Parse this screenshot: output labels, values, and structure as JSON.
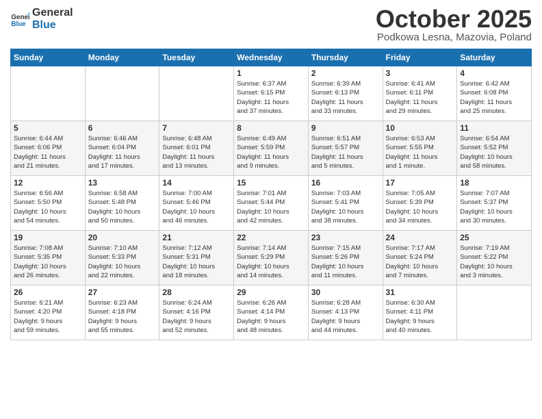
{
  "header": {
    "logo_general": "General",
    "logo_blue": "Blue",
    "month": "October 2025",
    "location": "Podkowa Lesna, Mazovia, Poland"
  },
  "days_of_week": [
    "Sunday",
    "Monday",
    "Tuesday",
    "Wednesday",
    "Thursday",
    "Friday",
    "Saturday"
  ],
  "weeks": [
    [
      {
        "day": "",
        "info": ""
      },
      {
        "day": "",
        "info": ""
      },
      {
        "day": "",
        "info": ""
      },
      {
        "day": "1",
        "info": "Sunrise: 6:37 AM\nSunset: 6:15 PM\nDaylight: 11 hours\nand 37 minutes."
      },
      {
        "day": "2",
        "info": "Sunrise: 6:39 AM\nSunset: 6:13 PM\nDaylight: 11 hours\nand 33 minutes."
      },
      {
        "day": "3",
        "info": "Sunrise: 6:41 AM\nSunset: 6:11 PM\nDaylight: 11 hours\nand 29 minutes."
      },
      {
        "day": "4",
        "info": "Sunrise: 6:42 AM\nSunset: 6:08 PM\nDaylight: 11 hours\nand 25 minutes."
      }
    ],
    [
      {
        "day": "5",
        "info": "Sunrise: 6:44 AM\nSunset: 6:06 PM\nDaylight: 11 hours\nand 21 minutes."
      },
      {
        "day": "6",
        "info": "Sunrise: 6:46 AM\nSunset: 6:04 PM\nDaylight: 11 hours\nand 17 minutes."
      },
      {
        "day": "7",
        "info": "Sunrise: 6:48 AM\nSunset: 6:01 PM\nDaylight: 11 hours\nand 13 minutes."
      },
      {
        "day": "8",
        "info": "Sunrise: 6:49 AM\nSunset: 5:59 PM\nDaylight: 11 hours\nand 9 minutes."
      },
      {
        "day": "9",
        "info": "Sunrise: 6:51 AM\nSunset: 5:57 PM\nDaylight: 11 hours\nand 5 minutes."
      },
      {
        "day": "10",
        "info": "Sunrise: 6:53 AM\nSunset: 5:55 PM\nDaylight: 11 hours\nand 1 minute."
      },
      {
        "day": "11",
        "info": "Sunrise: 6:54 AM\nSunset: 5:52 PM\nDaylight: 10 hours\nand 58 minutes."
      }
    ],
    [
      {
        "day": "12",
        "info": "Sunrise: 6:56 AM\nSunset: 5:50 PM\nDaylight: 10 hours\nand 54 minutes."
      },
      {
        "day": "13",
        "info": "Sunrise: 6:58 AM\nSunset: 5:48 PM\nDaylight: 10 hours\nand 50 minutes."
      },
      {
        "day": "14",
        "info": "Sunrise: 7:00 AM\nSunset: 5:46 PM\nDaylight: 10 hours\nand 46 minutes."
      },
      {
        "day": "15",
        "info": "Sunrise: 7:01 AM\nSunset: 5:44 PM\nDaylight: 10 hours\nand 42 minutes."
      },
      {
        "day": "16",
        "info": "Sunrise: 7:03 AM\nSunset: 5:41 PM\nDaylight: 10 hours\nand 38 minutes."
      },
      {
        "day": "17",
        "info": "Sunrise: 7:05 AM\nSunset: 5:39 PM\nDaylight: 10 hours\nand 34 minutes."
      },
      {
        "day": "18",
        "info": "Sunrise: 7:07 AM\nSunset: 5:37 PM\nDaylight: 10 hours\nand 30 minutes."
      }
    ],
    [
      {
        "day": "19",
        "info": "Sunrise: 7:08 AM\nSunset: 5:35 PM\nDaylight: 10 hours\nand 26 minutes."
      },
      {
        "day": "20",
        "info": "Sunrise: 7:10 AM\nSunset: 5:33 PM\nDaylight: 10 hours\nand 22 minutes."
      },
      {
        "day": "21",
        "info": "Sunrise: 7:12 AM\nSunset: 5:31 PM\nDaylight: 10 hours\nand 18 minutes."
      },
      {
        "day": "22",
        "info": "Sunrise: 7:14 AM\nSunset: 5:29 PM\nDaylight: 10 hours\nand 14 minutes."
      },
      {
        "day": "23",
        "info": "Sunrise: 7:15 AM\nSunset: 5:26 PM\nDaylight: 10 hours\nand 11 minutes."
      },
      {
        "day": "24",
        "info": "Sunrise: 7:17 AM\nSunset: 5:24 PM\nDaylight: 10 hours\nand 7 minutes."
      },
      {
        "day": "25",
        "info": "Sunrise: 7:19 AM\nSunset: 5:22 PM\nDaylight: 10 hours\nand 3 minutes."
      }
    ],
    [
      {
        "day": "26",
        "info": "Sunrise: 6:21 AM\nSunset: 4:20 PM\nDaylight: 9 hours\nand 59 minutes."
      },
      {
        "day": "27",
        "info": "Sunrise: 6:23 AM\nSunset: 4:18 PM\nDaylight: 9 hours\nand 55 minutes."
      },
      {
        "day": "28",
        "info": "Sunrise: 6:24 AM\nSunset: 4:16 PM\nDaylight: 9 hours\nand 52 minutes."
      },
      {
        "day": "29",
        "info": "Sunrise: 6:26 AM\nSunset: 4:14 PM\nDaylight: 9 hours\nand 48 minutes."
      },
      {
        "day": "30",
        "info": "Sunrise: 6:28 AM\nSunset: 4:13 PM\nDaylight: 9 hours\nand 44 minutes."
      },
      {
        "day": "31",
        "info": "Sunrise: 6:30 AM\nSunset: 4:11 PM\nDaylight: 9 hours\nand 40 minutes."
      },
      {
        "day": "",
        "info": ""
      }
    ]
  ]
}
